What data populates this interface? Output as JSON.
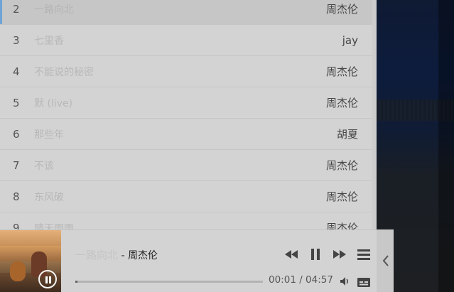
{
  "playlist": {
    "rows": [
      {
        "num": "2",
        "title": "一路向北",
        "artist": "周杰伦",
        "active": true
      },
      {
        "num": "3",
        "title": "七里香",
        "artist": "jay"
      },
      {
        "num": "4",
        "title": "不能说的秘密",
        "artist": "周杰伦"
      },
      {
        "num": "5",
        "title": "默 (live)",
        "artist": "周杰伦"
      },
      {
        "num": "6",
        "title": "那些年",
        "artist": "胡夏"
      },
      {
        "num": "7",
        "title": "不该",
        "artist": "周杰伦"
      },
      {
        "num": "8",
        "title": "东风破",
        "artist": "周杰伦"
      },
      {
        "num": "9",
        "title": "晴天雨雨",
        "artist": "周杰伦"
      }
    ]
  },
  "player": {
    "title": "一路向北",
    "separator": " - ",
    "artist": "周杰伦",
    "current_time": "00:01",
    "time_separator": " / ",
    "total_time": "04:57",
    "progress": 0.01,
    "icons": {
      "prev": "rewind-icon",
      "play_pause": "pause-icon",
      "next": "fast-forward-icon",
      "menu": "menu-icon",
      "volume": "volume-icon",
      "lyrics": "lyrics-icon",
      "collapse": "chevron-left-icon"
    }
  }
}
